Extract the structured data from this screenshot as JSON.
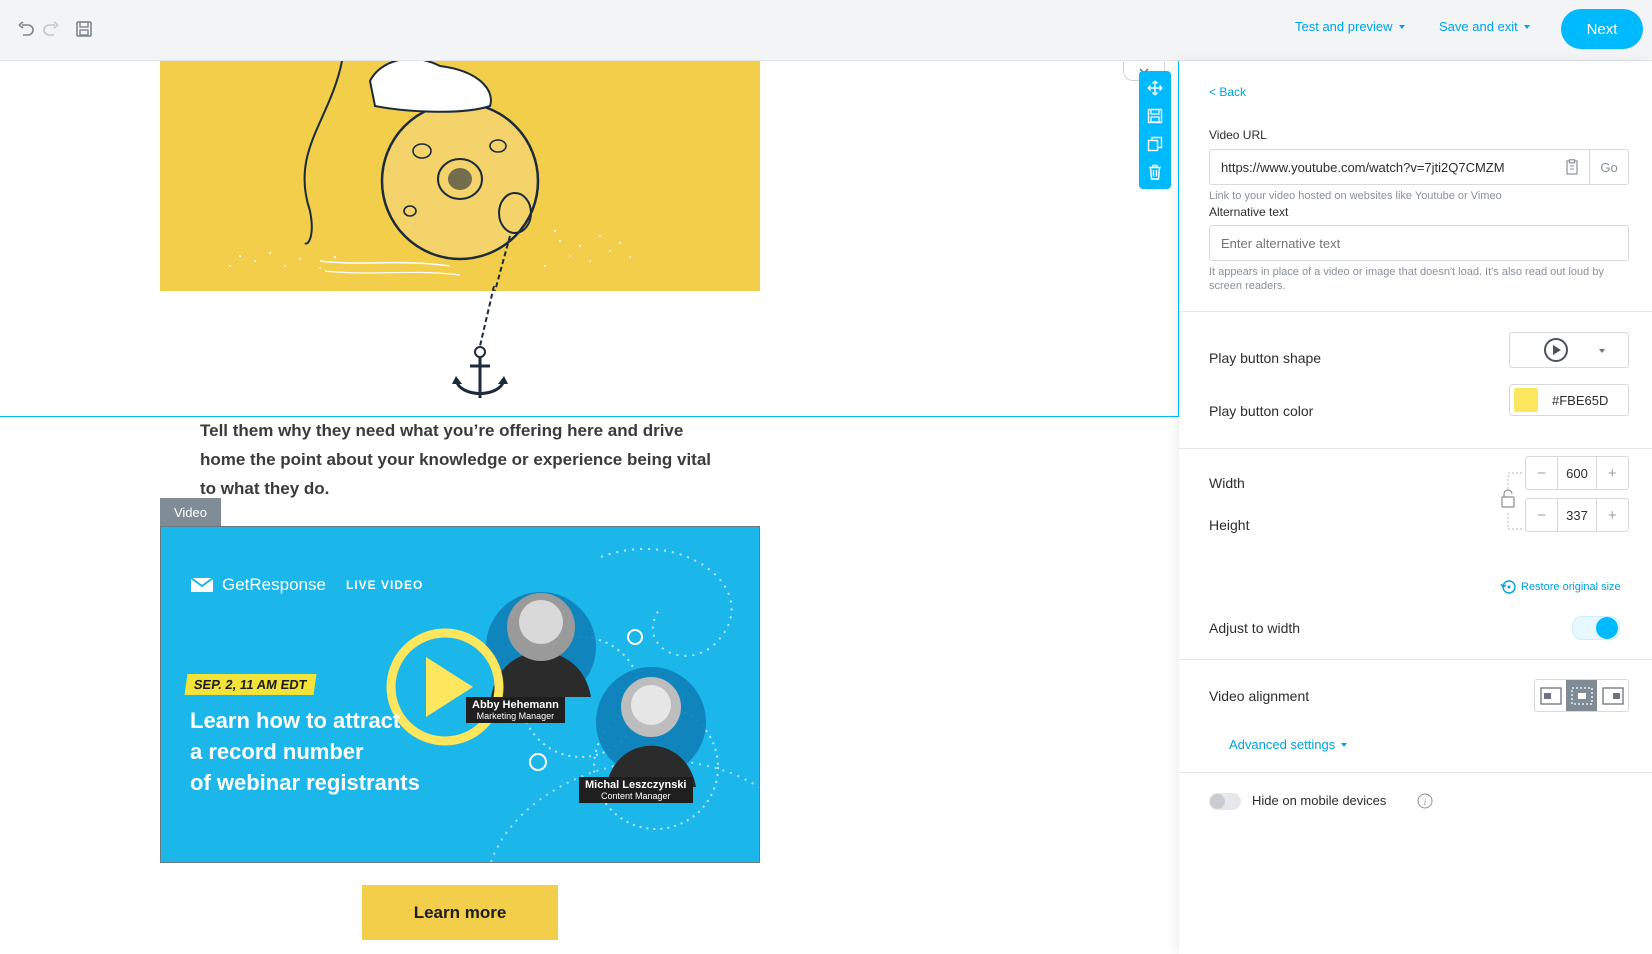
{
  "toolbar": {
    "undo_icon": "undo-icon",
    "redo_icon": "redo-icon",
    "save_icon": "save-icon",
    "test_preview_label": "Test and preview",
    "save_exit_label": "Save and exit",
    "next_label": "Next"
  },
  "canvas": {
    "body_text": "Tell them why they need what you’re offering here and drive home the point about your knowledge or experience being vital to what they do.",
    "video_tag": "Video",
    "learn_more_label": "Learn more",
    "video_thumbnail": {
      "brand": "GetResponse",
      "badge": "LIVE VIDEO",
      "date": "SEP. 2, 11 AM EDT",
      "headline_lines": [
        "Learn how to attract",
        "a record number",
        "of webinar registrants"
      ],
      "speaker1_name": "Abby Hehemann",
      "speaker1_role": "Marketing Manager",
      "speaker2_name": "Michal Leszczynski",
      "speaker2_role": "Content Manager"
    },
    "block_tools": [
      "move-icon",
      "save-block-icon",
      "duplicate-icon",
      "delete-icon"
    ]
  },
  "panel": {
    "back_label": "< Back",
    "video_url_label": "Video URL",
    "video_url_value": "https://www.youtube.com/watch?v=7jti2Q7CMZM",
    "go_label": "Go",
    "video_url_hint": "Link to your video hosted on websites like Youtube or Vimeo",
    "alt_text_label": "Alternative text",
    "alt_text_placeholder": "Enter alternative text",
    "alt_text_hint": "It appears in place of a video or image that doesn't load. It's also read out loud by screen readers.",
    "play_shape_label": "Play button shape",
    "play_color_label": "Play button color",
    "play_color_value": "#FBE65D",
    "width_label": "Width",
    "width_value": "600",
    "height_label": "Height",
    "height_value": "337",
    "restore_label": "Restore original size",
    "adjust_width_label": "Adjust to width",
    "adjust_width_on": true,
    "video_alignment_label": "Video alignment",
    "alignment_selected": "center",
    "advanced_settings_label": "Advanced settings",
    "hide_mobile_label": "Hide on mobile devices",
    "hide_mobile_on": false
  },
  "colors": {
    "accent": "#00baff",
    "link": "#00a3e0",
    "yellow": "#f2ce4b",
    "play_color_swatch": "#FBE65D",
    "video_bg": "#1bb6ea"
  }
}
